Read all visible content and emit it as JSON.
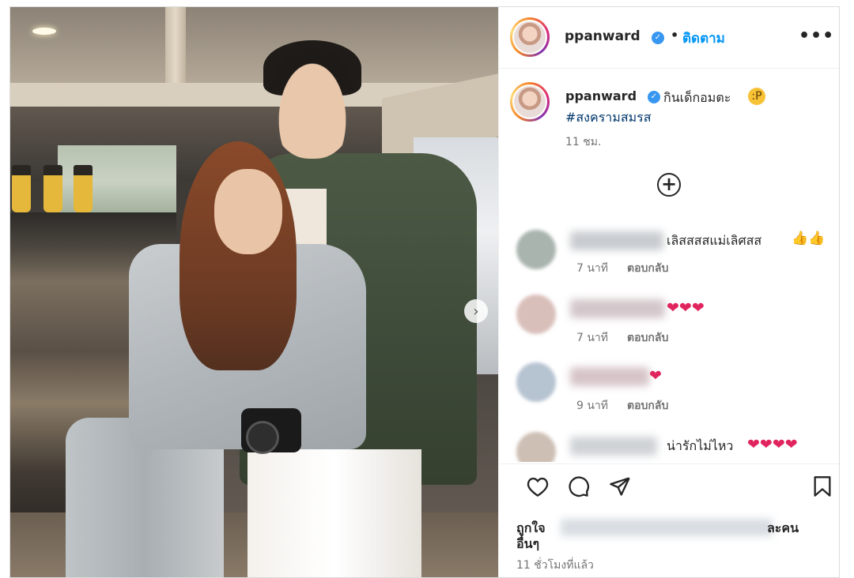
{
  "post": {
    "username": "ppanward",
    "follow_label": "ติดตาม",
    "dot": "•",
    "more_label": "•••",
    "caption_text": "กินเด็กอมตะ",
    "caption_emoji": "😝",
    "hashtag": "#สงครามสมรส",
    "caption_time": "11 ชม.",
    "load_more_label": "+",
    "carousel_next_label": "›"
  },
  "comments": [
    {
      "text": "เลิสสสสแม่เลิศสส",
      "trailing": "👍👍",
      "time": "7 นาที",
      "reply": "ตอบกลับ"
    },
    {
      "text": "",
      "trailing": "❤❤❤",
      "time": "7 นาที",
      "reply": "ตอบกลับ"
    },
    {
      "text": "",
      "trailing": "❤",
      "time": "9 นาที",
      "reply": "ตอบกลับ"
    },
    {
      "text": "น่ารักไม่ไหว",
      "trailing": "❤❤❤❤",
      "time": "",
      "reply": ""
    }
  ],
  "actions": {
    "like_icon": "heart-outline-icon",
    "comment_icon": "comment-bubble-icon",
    "share_icon": "paper-plane-icon",
    "save_icon": "bookmark-icon"
  },
  "likes": {
    "prefix": "ถูกใจ",
    "suffix": "ละคน",
    "line2": "อื่นๆ"
  },
  "post_time": "11 ชั่วโมงที่แล้ว",
  "colors": {
    "link_blue": "#0095f6",
    "hashtag_blue": "#00376b",
    "verified_blue": "#3897f0",
    "heart_red": "#e0245e",
    "muted_text": "#737373"
  }
}
